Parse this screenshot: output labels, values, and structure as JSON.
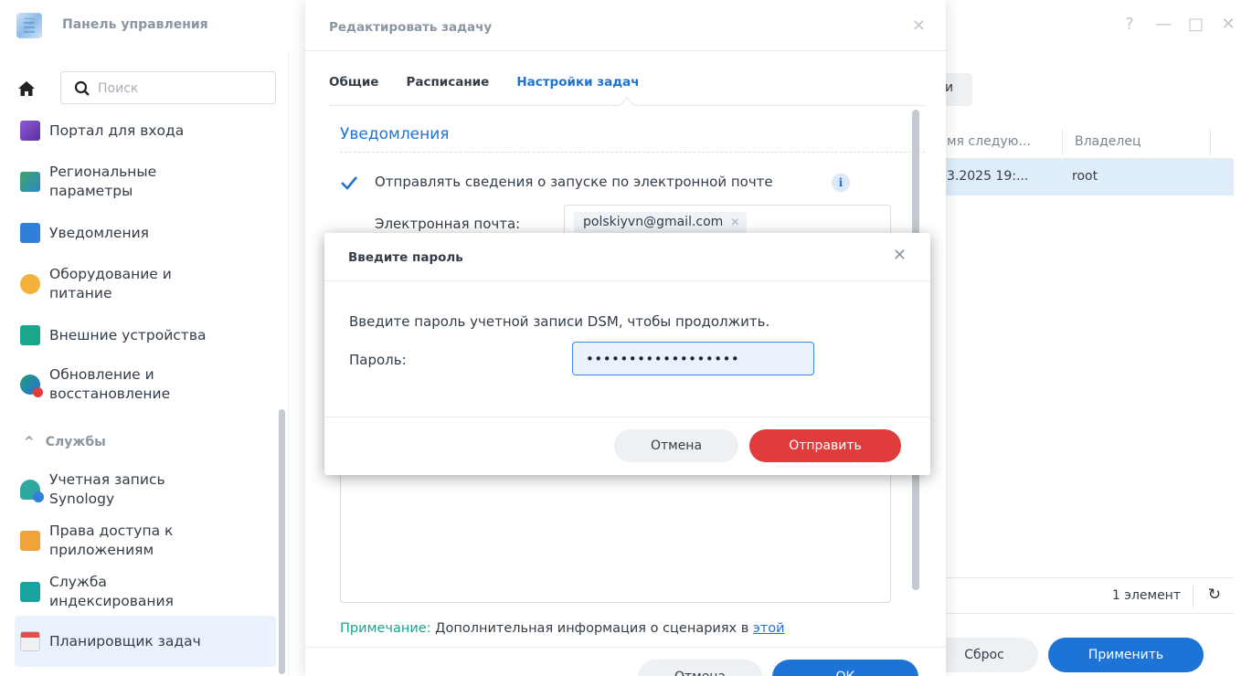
{
  "control_panel": {
    "title": "Панель управления",
    "window_controls": {
      "help": "?",
      "minimize": "—",
      "maximize": "□",
      "close": "✕"
    },
    "search": {
      "placeholder": "Поиск"
    },
    "sidebar": {
      "items": [
        {
          "label": "Портал для входа",
          "icon": "login-portal-icon"
        },
        {
          "label": "Региональные параметры",
          "icon": "regional-options-icon"
        },
        {
          "label": "Уведомления",
          "icon": "notification-icon"
        },
        {
          "label": "Оборудование и питание",
          "icon": "hardware-power-icon"
        },
        {
          "label": "Внешние устройства",
          "icon": "external-devices-icon"
        },
        {
          "label": "Обновление и восстановление",
          "icon": "update-restore-icon"
        }
      ],
      "services_section": "Службы",
      "service_items": [
        {
          "label": "Учетная запись Synology",
          "icon": "synology-account-icon"
        },
        {
          "label": "Права доступа к приложениям",
          "icon": "app-privileges-icon"
        },
        {
          "label": "Служба индексирования",
          "icon": "indexing-service-icon"
        },
        {
          "label": "Планировщик задач",
          "icon": "task-scheduler-icon",
          "active": true
        }
      ]
    },
    "content": {
      "tab_fragment": "и",
      "columns": [
        "мя следую...",
        "Владелец"
      ],
      "row": {
        "next_run": "3.2025 19:...",
        "owner": "root"
      },
      "item_count": "1 элемент",
      "reset_label": "Сброс",
      "apply_label": "Применить"
    }
  },
  "edit_task": {
    "title": "Редактировать задачу",
    "tabs": [
      "Общие",
      "Расписание",
      "Настройки задач"
    ],
    "active_tab": "Настройки задач",
    "section_title": "Уведомления",
    "send_email_checkbox": {
      "label": "Отправлять сведения о запуске по электронной почте",
      "checked": true
    },
    "email_label": "Электронная почта:",
    "email_value": "polskiyvn@gmail.com",
    "note_label": "Примечание:",
    "note_text": " Дополнительная информация о сценариях в ",
    "note_link": "этой",
    "cancel_label": "Отмена",
    "ok_label": "ОК"
  },
  "password_dialog": {
    "title": "Введите пароль",
    "message": "Введите пароль учетной записи DSM, чтобы продолжить.",
    "password_label": "Пароль:",
    "password_value": "••••••••••••••••••",
    "cancel_label": "Отмена",
    "submit_label": "Отправить",
    "submit_color": "#e13c3c"
  },
  "colors": {
    "accent": "#1f72d1",
    "primary_button": "#1d74d6",
    "danger_button": "#e13c3c",
    "selected_row": "#dfedfb"
  }
}
